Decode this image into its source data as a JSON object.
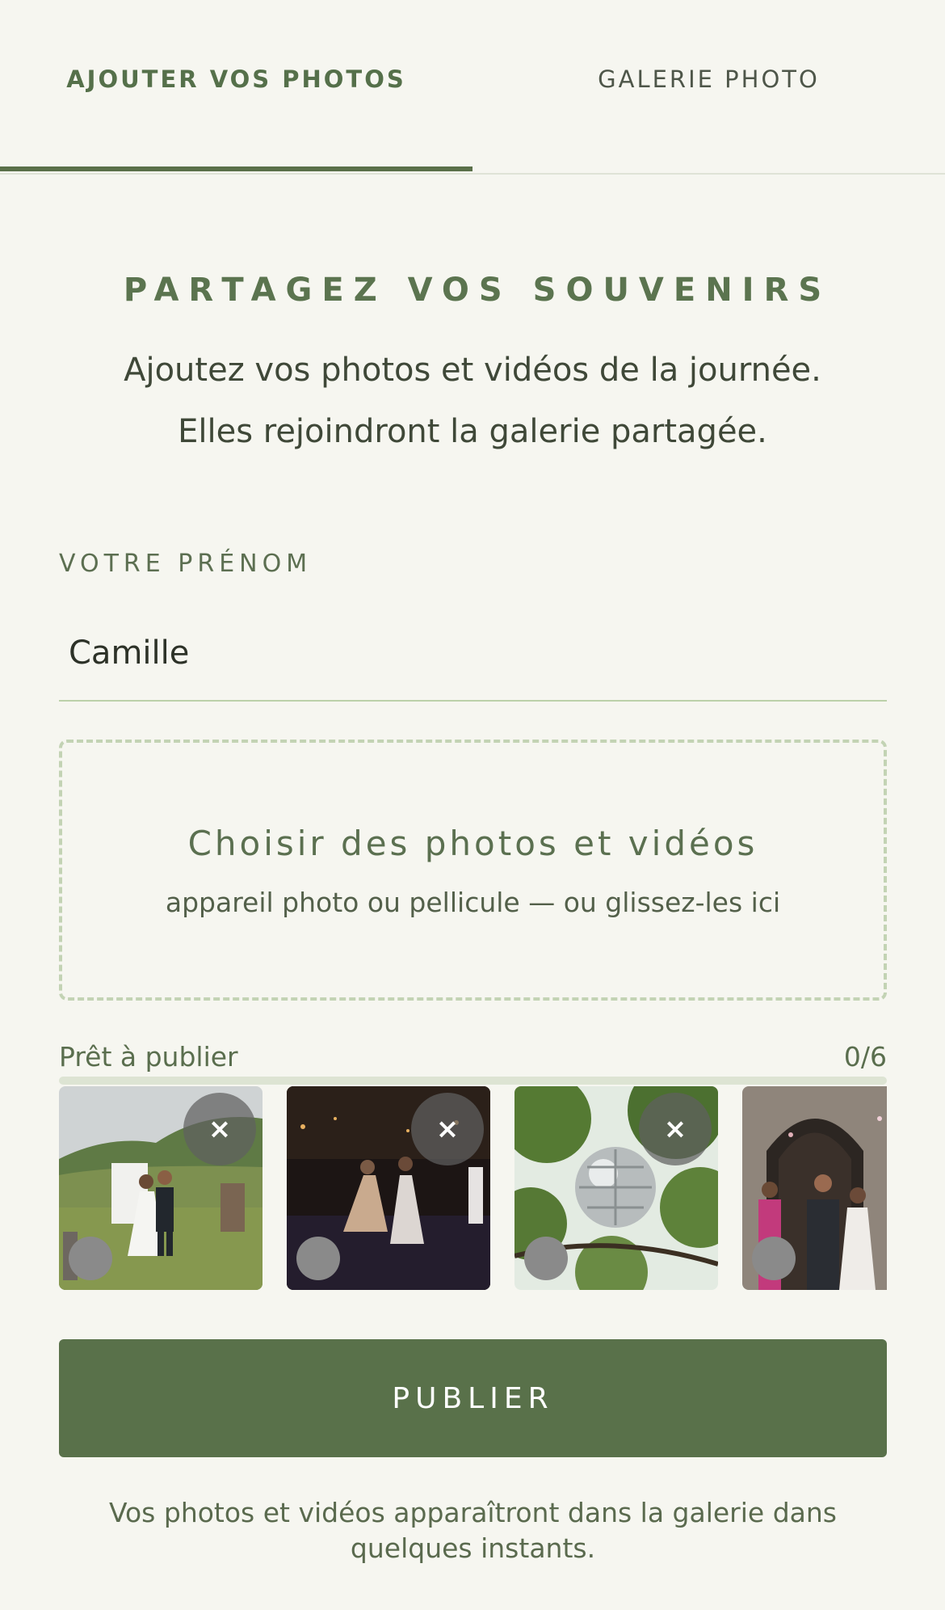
{
  "tabs": [
    {
      "label": "AJOUTER VOS PHOTOS",
      "active": true
    },
    {
      "label": "GALERIE PHOTO",
      "active": false
    }
  ],
  "intro": {
    "heading": "PARTAGEZ VOS SOUVENIRS",
    "line1": "Ajoutez vos photos et vidéos de la journée.",
    "line2": "Elles rejoindront la galerie partagée."
  },
  "name_field": {
    "label": "VOTRE PRÉNOM",
    "value": "Camille"
  },
  "dropzone": {
    "title": "Choisir des photos et vidéos",
    "subtitle": "appareil photo ou pellicule — ou glissez-les ici"
  },
  "ready": {
    "label": "Prêt à publier",
    "count": "0/6",
    "progress": 0
  },
  "thumbnails": [
    {
      "remove_label": "×",
      "scene": "wedding-couple-walking"
    },
    {
      "remove_label": "×",
      "scene": "dance-floor-night"
    },
    {
      "remove_label": "×",
      "scene": "disco-ball-in-tree"
    },
    {
      "remove_label": "×",
      "scene": "church-exit-confetti"
    }
  ],
  "publish_button": {
    "label": "PUBLIER"
  },
  "footer_note": "Vos photos et vidéos apparaîtront dans la galerie dans quelques instants.",
  "colors": {
    "accent": "#5a7049",
    "background": "#f6f6f0",
    "dashed_border": "#c3d3b4"
  }
}
